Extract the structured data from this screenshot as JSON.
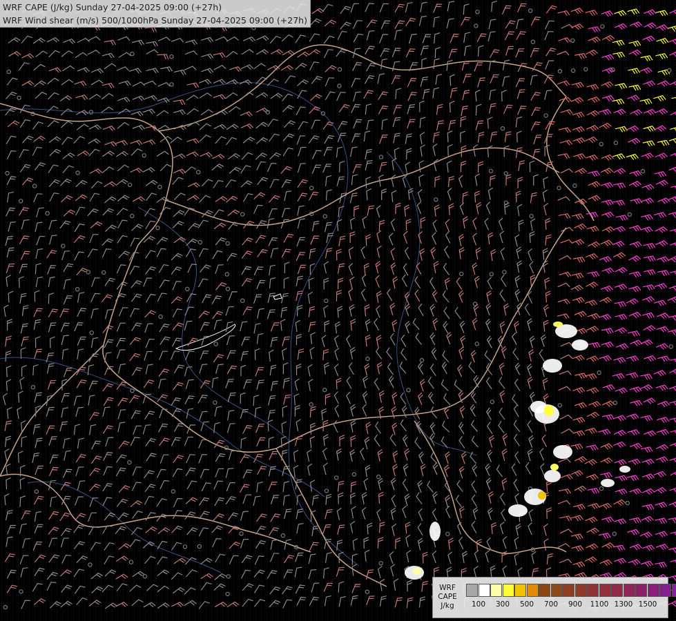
{
  "header": {
    "line1": "WRF CAPE (J/kg) Sunday 27-04-2025 09:00 (+27h)",
    "line2": "WRF Wind shear (m/s) 500/1000hPa Sunday 27-04-2025 09:00 (+27h)"
  },
  "legend": {
    "title_lines": [
      "WRF",
      "CAPE",
      "J/kg"
    ],
    "colors": [
      "#a8a8a8",
      "#ffffff",
      "#ffffaa",
      "#ffff33",
      "#f2c200",
      "#e08a00",
      "#8b4513",
      "#8b4a1c",
      "#8e3f22",
      "#8f3a2a",
      "#913534",
      "#92303e",
      "#922b4a",
      "#8e2658",
      "#8a2168",
      "#86207a",
      "#84208c",
      "#82209e"
    ],
    "tick_labels": [
      "100",
      "300",
      "500",
      "700",
      "900",
      "1100",
      "1300",
      "1500"
    ]
  },
  "map": {
    "background": "#000000",
    "border_color": "#e8c4a0",
    "river_color": "#4a6fb0",
    "cape_area_color": "#ffffff",
    "barb_colors": [
      "#8a8a8a",
      "#9b8a8a",
      "#c27a76",
      "#e06a6a",
      "#ff3fd0",
      "#ffff30"
    ]
  }
}
